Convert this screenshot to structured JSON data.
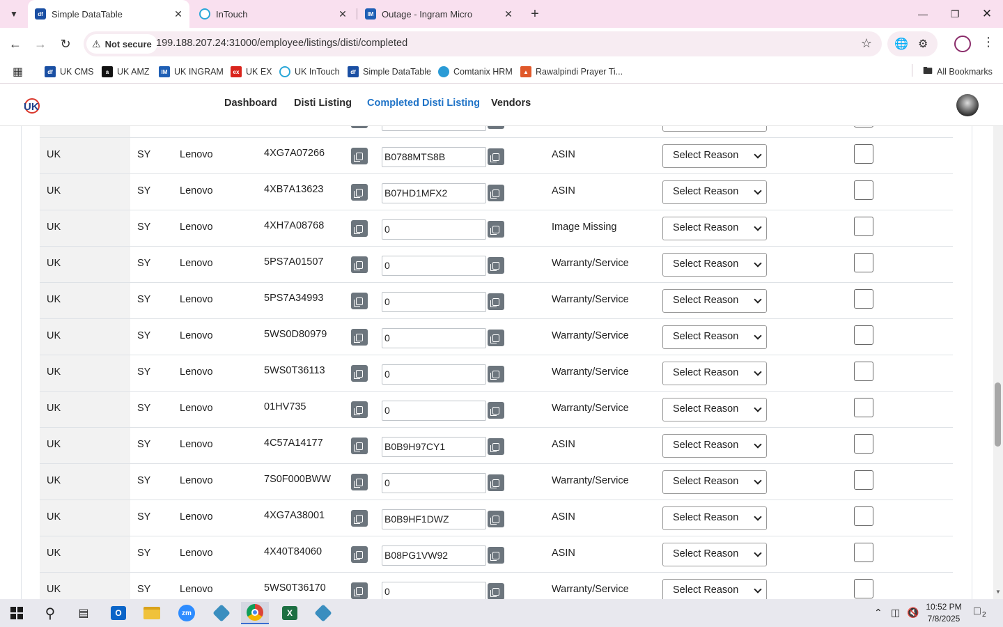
{
  "browser": {
    "tabs": [
      {
        "label": "Simple DataTable",
        "favicon": "df",
        "active": true
      },
      {
        "label": "InTouch",
        "favicon": "intouch-icon",
        "active": false
      },
      {
        "label": "Outage - Ingram Micro",
        "favicon": "IM",
        "active": false
      }
    ],
    "security_label": "Not secure",
    "url": "199.188.207.24:31000/employee/listings/disti/completed",
    "bookmarks": [
      {
        "label": "UK CMS",
        "icon": "df"
      },
      {
        "label": "UK AMZ",
        "icon": "a"
      },
      {
        "label": "UK INGRAM",
        "icon": "IM"
      },
      {
        "label": "UK EX",
        "icon": "ex"
      },
      {
        "label": "UK InTouch",
        "icon": "intouch-icon"
      },
      {
        "label": "Simple DataTable",
        "icon": "df"
      },
      {
        "label": "Comtanix HRM",
        "icon": "comtanix-icon"
      },
      {
        "label": "Rawalpindi Prayer Ti...",
        "icon": "prayer-icon"
      }
    ],
    "all_bookmarks_label": "All Bookmarks"
  },
  "app": {
    "nav": [
      {
        "label": "Dashboard",
        "active": false
      },
      {
        "label": "Disti Listing",
        "active": false
      },
      {
        "label": "Completed Disti Listing",
        "active": true
      },
      {
        "label": "Vendors",
        "active": false
      }
    ]
  },
  "table": {
    "reason_placeholder": "Select Reason",
    "rows": [
      {
        "country": "",
        "code": "",
        "vendor": "",
        "sku": "",
        "asin": "",
        "status": ""
      },
      {
        "country": "UK",
        "code": "SY",
        "vendor": "Lenovo",
        "sku": "4XG7A07266",
        "asin": "B0788MTS8B",
        "status": "ASIN"
      },
      {
        "country": "UK",
        "code": "SY",
        "vendor": "Lenovo",
        "sku": "4XB7A13623",
        "asin": "B07HD1MFX2",
        "status": "ASIN"
      },
      {
        "country": "UK",
        "code": "SY",
        "vendor": "Lenovo",
        "sku": "4XH7A08768",
        "asin": "0",
        "status": "Image Missing"
      },
      {
        "country": "UK",
        "code": "SY",
        "vendor": "Lenovo",
        "sku": "5PS7A01507",
        "asin": "0",
        "status": "Warranty/Service"
      },
      {
        "country": "UK",
        "code": "SY",
        "vendor": "Lenovo",
        "sku": "5PS7A34993",
        "asin": "0",
        "status": "Warranty/Service"
      },
      {
        "country": "UK",
        "code": "SY",
        "vendor": "Lenovo",
        "sku": "5WS0D80979",
        "asin": "0",
        "status": "Warranty/Service"
      },
      {
        "country": "UK",
        "code": "SY",
        "vendor": "Lenovo",
        "sku": "5WS0T36113",
        "asin": "0",
        "status": "Warranty/Service"
      },
      {
        "country": "UK",
        "code": "SY",
        "vendor": "Lenovo",
        "sku": "01HV735",
        "asin": "0",
        "status": "Warranty/Service"
      },
      {
        "country": "UK",
        "code": "SY",
        "vendor": "Lenovo",
        "sku": "4C57A14177",
        "asin": "B0B9H97CY1",
        "status": "ASIN"
      },
      {
        "country": "UK",
        "code": "SY",
        "vendor": "Lenovo",
        "sku": "7S0F000BWW",
        "asin": "0",
        "status": "Warranty/Service"
      },
      {
        "country": "UK",
        "code": "SY",
        "vendor": "Lenovo",
        "sku": "4XG7A38001",
        "asin": "B0B9HF1DWZ",
        "status": "ASIN"
      },
      {
        "country": "UK",
        "code": "SY",
        "vendor": "Lenovo",
        "sku": "4X40T84060",
        "asin": "B08PG1VW92",
        "status": "ASIN"
      },
      {
        "country": "UK",
        "code": "SY",
        "vendor": "Lenovo",
        "sku": "5WS0T36170",
        "asin": "0",
        "status": "Warranty/Service"
      }
    ]
  },
  "taskbar": {
    "time": "10:52 PM",
    "date": "7/8/2025",
    "notification_count": "2",
    "apps": [
      "start-icon",
      "search-icon",
      "task-view-icon",
      "outlook-icon",
      "file-explorer-icon",
      "zoom-icon",
      "app-icon",
      "chrome-icon",
      "excel-icon",
      "app-icon"
    ]
  },
  "colors": {
    "tabstrip": "#f9e0ef",
    "active_nav": "#1f73c7",
    "copy_button": "#6c757d",
    "first_column_bg": "#f2f2f2"
  }
}
